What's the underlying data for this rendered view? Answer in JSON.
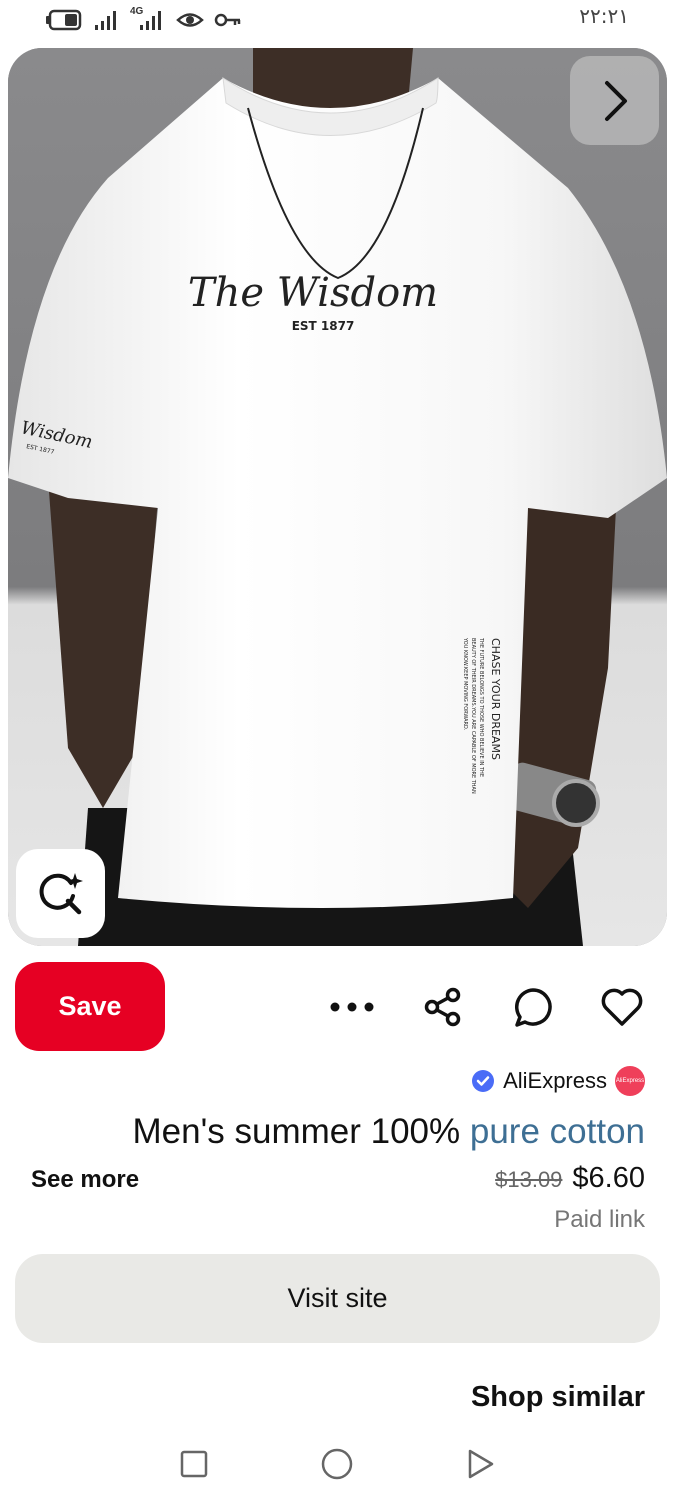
{
  "status_bar": {
    "time": "۲۲:۲۱",
    "network_label": "4G",
    "icons": [
      "battery-icon",
      "signal-icon",
      "4g-signal-icon",
      "eye-icon",
      "key-icon"
    ]
  },
  "pin": {
    "print_main": "The Wisdom",
    "print_est": "EST 1877",
    "sleeve_print": "Wisdom",
    "sleeve_est": "EST 1877",
    "side_print_title": "CHASE YOUR DREAMS",
    "side_print_lines": [
      "THE FUTURE BELONGS TO THOSE WHO BELIEVE IN THE",
      "BEAUTY OF THEIR DREAMS.YOU ARE CAPABLE OF MORE THAN",
      "YOU KNOW.KEEP MOVING FORWARD."
    ]
  },
  "actions": {
    "save_label": "Save",
    "icons": [
      "more-icon",
      "share-icon",
      "comment-icon",
      "heart-icon"
    ]
  },
  "source": {
    "name": "AliExpress",
    "avatar_text": "AliExpress",
    "verified": true
  },
  "product": {
    "title_main": "Men's summer 100% ",
    "title_link": "pure cotton",
    "see_more": "See more",
    "price_original": "$13.09",
    "price_current": "$6.60",
    "paid_link": "Paid link"
  },
  "visit_label": "Visit site",
  "shop_similar": "Shop similar",
  "nav": [
    "recents-icon",
    "home-icon",
    "back-icon"
  ],
  "colors": {
    "save": "#e60023",
    "link": "#3e6f94",
    "visit_bg": "#e9e9e6",
    "verified": "#4a6cf7"
  }
}
